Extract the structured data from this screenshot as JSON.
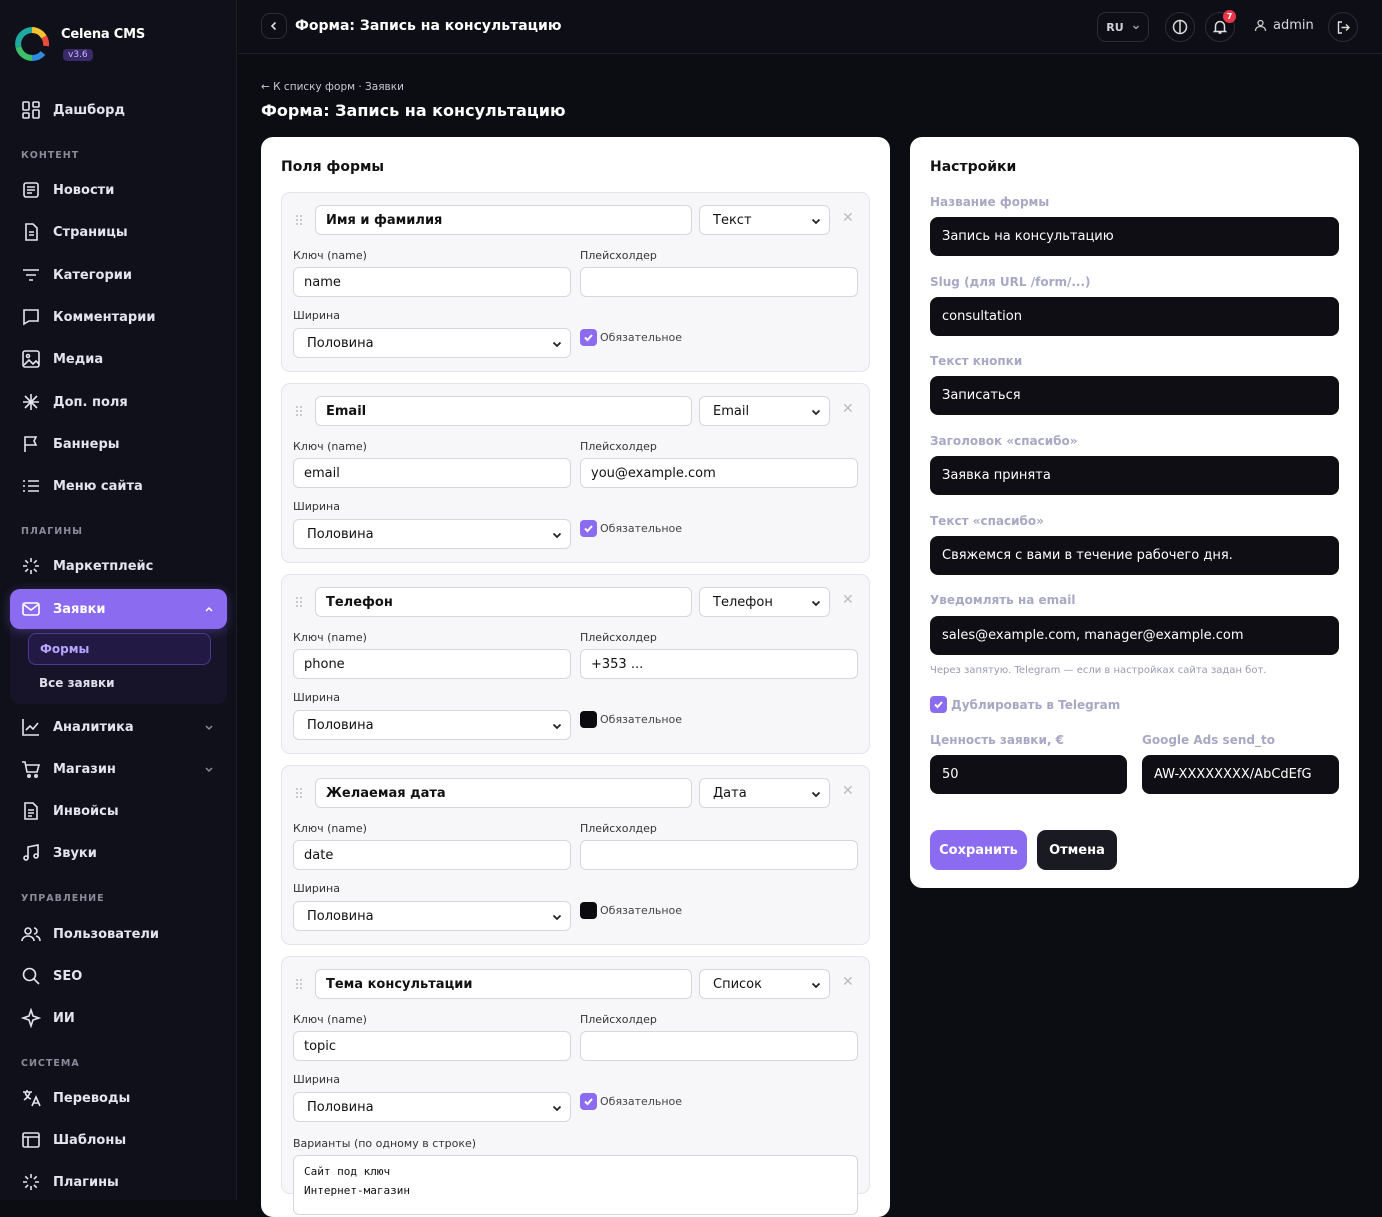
{
  "app": {
    "name": "Celena CMS",
    "version": "v3.6"
  },
  "sidebar": {
    "dashboard": "Дашборд",
    "sections": {
      "content": "КОНТЕНТ",
      "plugins": "ПЛАГИНЫ",
      "management": "УПРАВЛЕНИЕ",
      "system": "СИСТЕМА"
    },
    "items": {
      "news": "Новости",
      "pages": "Страницы",
      "categories": "Категории",
      "comments": "Комментарии",
      "media": "Медиа",
      "fields": "Доп. поля",
      "banners": "Баннеры",
      "menu": "Меню сайта",
      "marketplace": "Маркетплейс",
      "requests": "Заявки",
      "analytics": "Аналитика",
      "shop": "Магазин",
      "invoices": "Инвойсы",
      "sounds": "Звуки",
      "users": "Пользователи",
      "seo": "SEO",
      "ai": "ИИ",
      "translations": "Переводы",
      "templates": "Шаблоны",
      "plugins": "Плагины"
    },
    "requests_sub": {
      "forms": "Формы",
      "all": "Все заявки"
    }
  },
  "topbar": {
    "title": "Форма: Запись на консультацию",
    "lang": "RU",
    "notifications": "7",
    "user": "admin"
  },
  "breadcrumb": "← К списку форм · Заявки",
  "page_title": "Форма: Запись на консультацию",
  "labels": {
    "key": "Ключ (name)",
    "placeholder": "Плейсхолдер",
    "width": "Ширина",
    "required": "Обязательное",
    "options": "Варианты (по одному в строке)"
  },
  "fields_card": {
    "title": "Поля формы",
    "fields": [
      {
        "label": "Имя и фамилия",
        "type": "Текст",
        "key": "name",
        "placeholder": "",
        "width": "Половина",
        "required": true
      },
      {
        "label": "Email",
        "type": "Email",
        "key": "email",
        "placeholder": "you@example.com",
        "width": "Половина",
        "required": true
      },
      {
        "label": "Телефон",
        "type": "Телефон",
        "key": "phone",
        "placeholder": "+353 ...",
        "width": "Половина",
        "required": false
      },
      {
        "label": "Желаемая дата",
        "type": "Дата",
        "key": "date",
        "placeholder": "",
        "width": "Половина",
        "required": false
      },
      {
        "label": "Тема консультации",
        "type": "Список",
        "key": "topic",
        "placeholder": "",
        "width": "Половина",
        "required": true,
        "options": "Сайт под ключ\nИнтернет-магазин"
      }
    ]
  },
  "settings": {
    "title": "Настройки",
    "form_name_label": "Название формы",
    "form_name": "Запись на консультацию",
    "slug_label": "Slug (для URL /form/...)",
    "slug": "consultation",
    "button_label": "Текст кнопки",
    "button_text": "Записаться",
    "thanks_title_label": "Заголовок «спасибо»",
    "thanks_title": "Заявка принята",
    "thanks_text_label": "Текст «спасибо»",
    "thanks_text": "Свяжемся с вами в течение рабочего дня.",
    "notify_label": "Уведомлять на email",
    "notify": "sales@example.com, manager@example.com",
    "notify_hint": "Через запятую. Telegram — если в настройках сайта задан бот.",
    "telegram_label": "Дублировать в Telegram",
    "telegram": true,
    "value_label": "Ценность заявки, €",
    "value": "50",
    "ads_label": "Google Ads send_to",
    "ads": "AW-XXXXXXXX/AbCdEfG",
    "save": "Сохранить",
    "cancel": "Отмена"
  },
  "colors": {
    "accent": "#8b6cf0",
    "bg": "#0c0c13",
    "card": "#ffffff"
  }
}
